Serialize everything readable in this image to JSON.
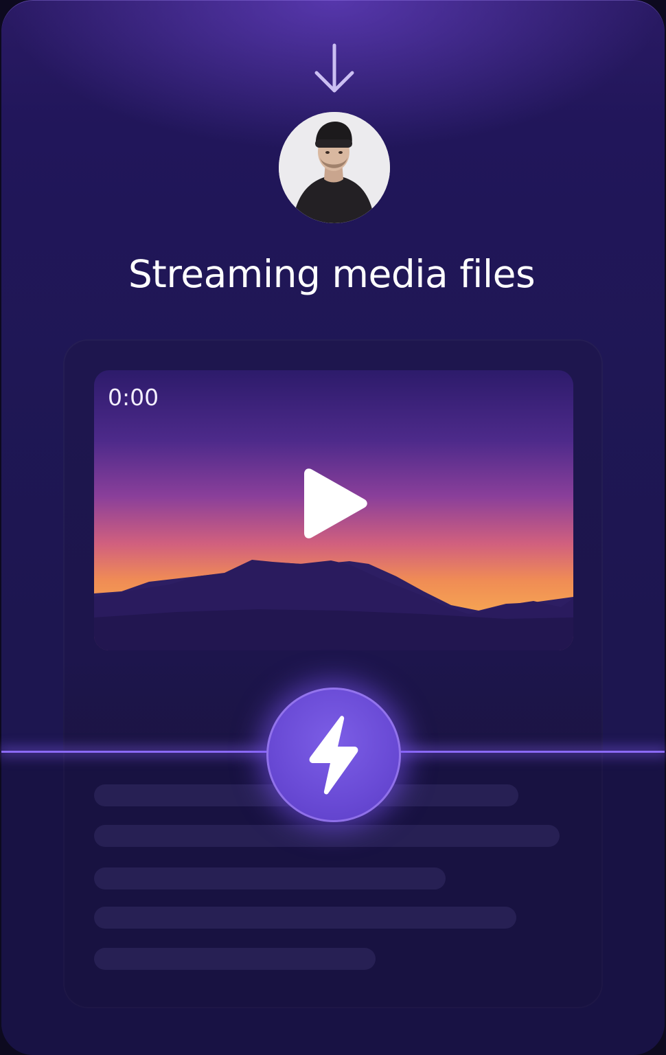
{
  "header": {
    "arrow_icon": "arrow-down-icon",
    "avatar_icon": "user-avatar"
  },
  "title": "Streaming media files",
  "player": {
    "time": "0:00",
    "play_icon": "play-icon"
  },
  "accent_icon": "lightning-bolt-icon",
  "colors": {
    "background": "#1f1755",
    "accent": "#8b6af5",
    "text": "#ffffff"
  }
}
